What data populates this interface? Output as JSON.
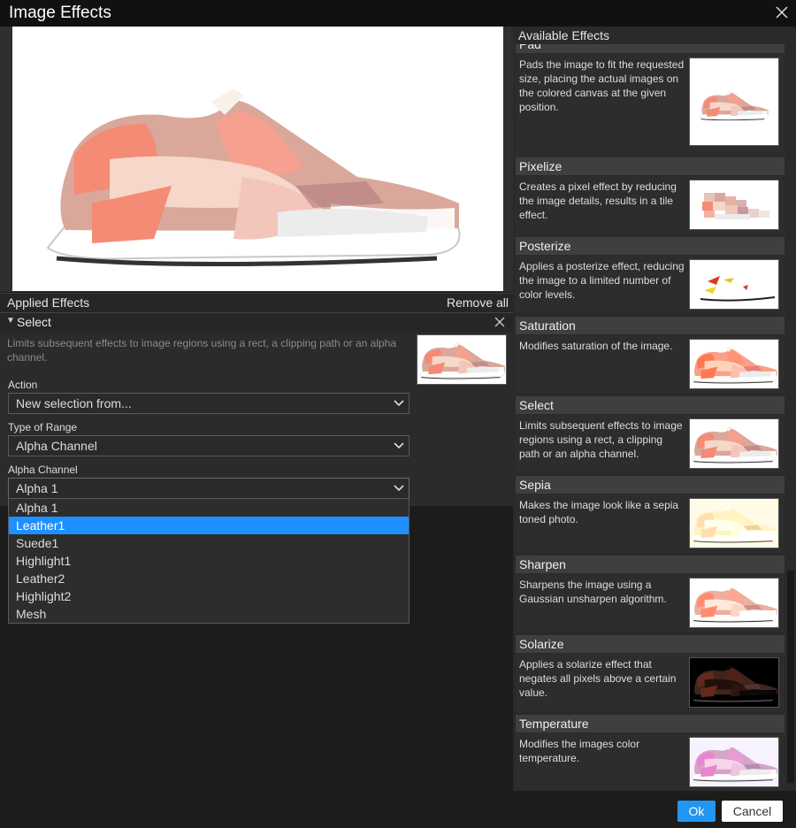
{
  "window": {
    "title": "Image Effects",
    "close_icon": "close-icon"
  },
  "applied": {
    "header": "Applied Effects",
    "remove_all": "Remove all"
  },
  "select_effect": {
    "name": "Select",
    "description": "Limits subsequent effects to image regions using a rect, a clipping path or an alpha channel.",
    "action_label": "Action",
    "action_value": "New selection from...",
    "range_label": "Type of Range",
    "range_value": "Alpha Channel",
    "channel_label": "Alpha Channel",
    "channel_value": "Alpha 1"
  },
  "dropdown": {
    "options": [
      "Alpha 1",
      "Leather1",
      "Suede1",
      "Highlight1",
      "Leather2",
      "Highlight2",
      "Mesh"
    ],
    "highlighted": "Leather1"
  },
  "available": {
    "title": "Available Effects",
    "items": [
      {
        "name": "Pad",
        "desc": "Pads the image to fit the requested size, placing the actual images on the colored canvas at the given position."
      },
      {
        "name": "Pixelize",
        "desc": "Creates a pixel effect by reducing the image details, results in a tile effect."
      },
      {
        "name": "Posterize",
        "desc": "Applies a posterize effect, reducing the image to a limited number of color levels."
      },
      {
        "name": "Saturation",
        "desc": "Modifies saturation of the image."
      },
      {
        "name": "Select",
        "desc": "Limits subsequent effects to image regions using a rect, a clipping path or an alpha channel."
      },
      {
        "name": "Sepia",
        "desc": "Makes the image look like a sepia toned photo."
      },
      {
        "name": "Sharpen",
        "desc": "Sharpens the image using a Gaussian unsharpen algorithm."
      },
      {
        "name": "Solarize",
        "desc": "Applies a solarize effect that negates all pixels above a certain value."
      },
      {
        "name": "Temperature",
        "desc": "Modifies the images color temperature."
      }
    ]
  },
  "buttons": {
    "ok": "Ok",
    "cancel": "Cancel"
  },
  "colors": {
    "accent": "#2196f3",
    "highlight": "#1e90ff",
    "background": "#1c1c1c"
  }
}
